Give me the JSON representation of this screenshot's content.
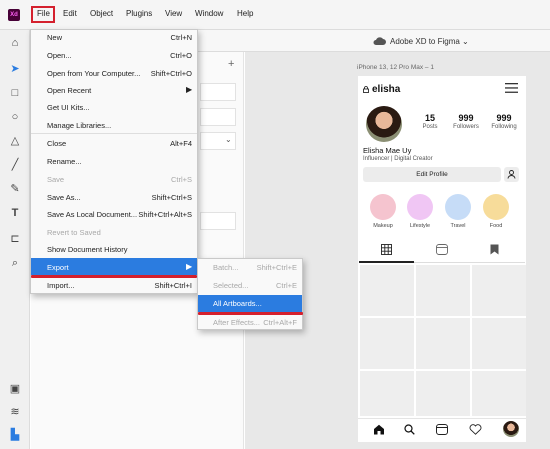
{
  "app": {
    "logo_text": "Xd",
    "share_label": "Adobe XD to Figma"
  },
  "menubar": [
    "File",
    "Edit",
    "Object",
    "Plugins",
    "View",
    "Window",
    "Help"
  ],
  "file_menu": {
    "new": {
      "label": "New",
      "shortcut": "Ctrl+N"
    },
    "open": {
      "label": "Open...",
      "shortcut": "Ctrl+O"
    },
    "open_from_computer": {
      "label": "Open from Your Computer...",
      "shortcut": "Shift+Ctrl+O"
    },
    "open_recent": {
      "label": "Open Recent"
    },
    "get_ui_kits": {
      "label": "Get UI Kits..."
    },
    "manage_libraries": {
      "label": "Manage Libraries..."
    },
    "close": {
      "label": "Close",
      "shortcut": "Alt+F4"
    },
    "rename": {
      "label": "Rename..."
    },
    "save": {
      "label": "Save",
      "shortcut": "Ctrl+S"
    },
    "save_as": {
      "label": "Save As...",
      "shortcut": "Shift+Ctrl+S"
    },
    "save_as_local": {
      "label": "Save As Local Document...",
      "shortcut": "Shift+Ctrl+Alt+S"
    },
    "revert": {
      "label": "Revert to Saved"
    },
    "show_history": {
      "label": "Show Document History"
    },
    "export": {
      "label": "Export"
    },
    "import": {
      "label": "Import...",
      "shortcut": "Shift+Ctrl+I"
    }
  },
  "export_menu": {
    "batch": {
      "label": "Batch...",
      "shortcut": "Shift+Ctrl+E"
    },
    "selected": {
      "label": "Selected...",
      "shortcut": "Ctrl+E"
    },
    "all_artboards": {
      "label": "All Artboards..."
    },
    "after_effects": {
      "label": "After Effects...",
      "shortcut": "Ctrl+Alt+F"
    }
  },
  "canvas": {
    "artboard_label": "iPhone 13, 12 Pro Max – 1"
  },
  "profile": {
    "handle": "elisha",
    "posts": {
      "value": "15",
      "label": "Posts"
    },
    "followers": {
      "value": "999",
      "label": "Followers"
    },
    "following": {
      "value": "999",
      "label": "Following"
    },
    "name": "Elisha Mae Uy",
    "bio": "Influencer | Digital Creator",
    "edit_profile": "Edit Profile",
    "highlights": [
      {
        "label": "Makeup",
        "color": "#f5c4cf"
      },
      {
        "label": "Lifestyle",
        "color": "#f0c6f4"
      },
      {
        "label": "Travel",
        "color": "#c6dcf7"
      },
      {
        "label": "Food",
        "color": "#f7dc9a"
      }
    ]
  },
  "colors": {
    "highlight_blue": "#2b7ce0",
    "annotation_red": "#d4202d"
  }
}
